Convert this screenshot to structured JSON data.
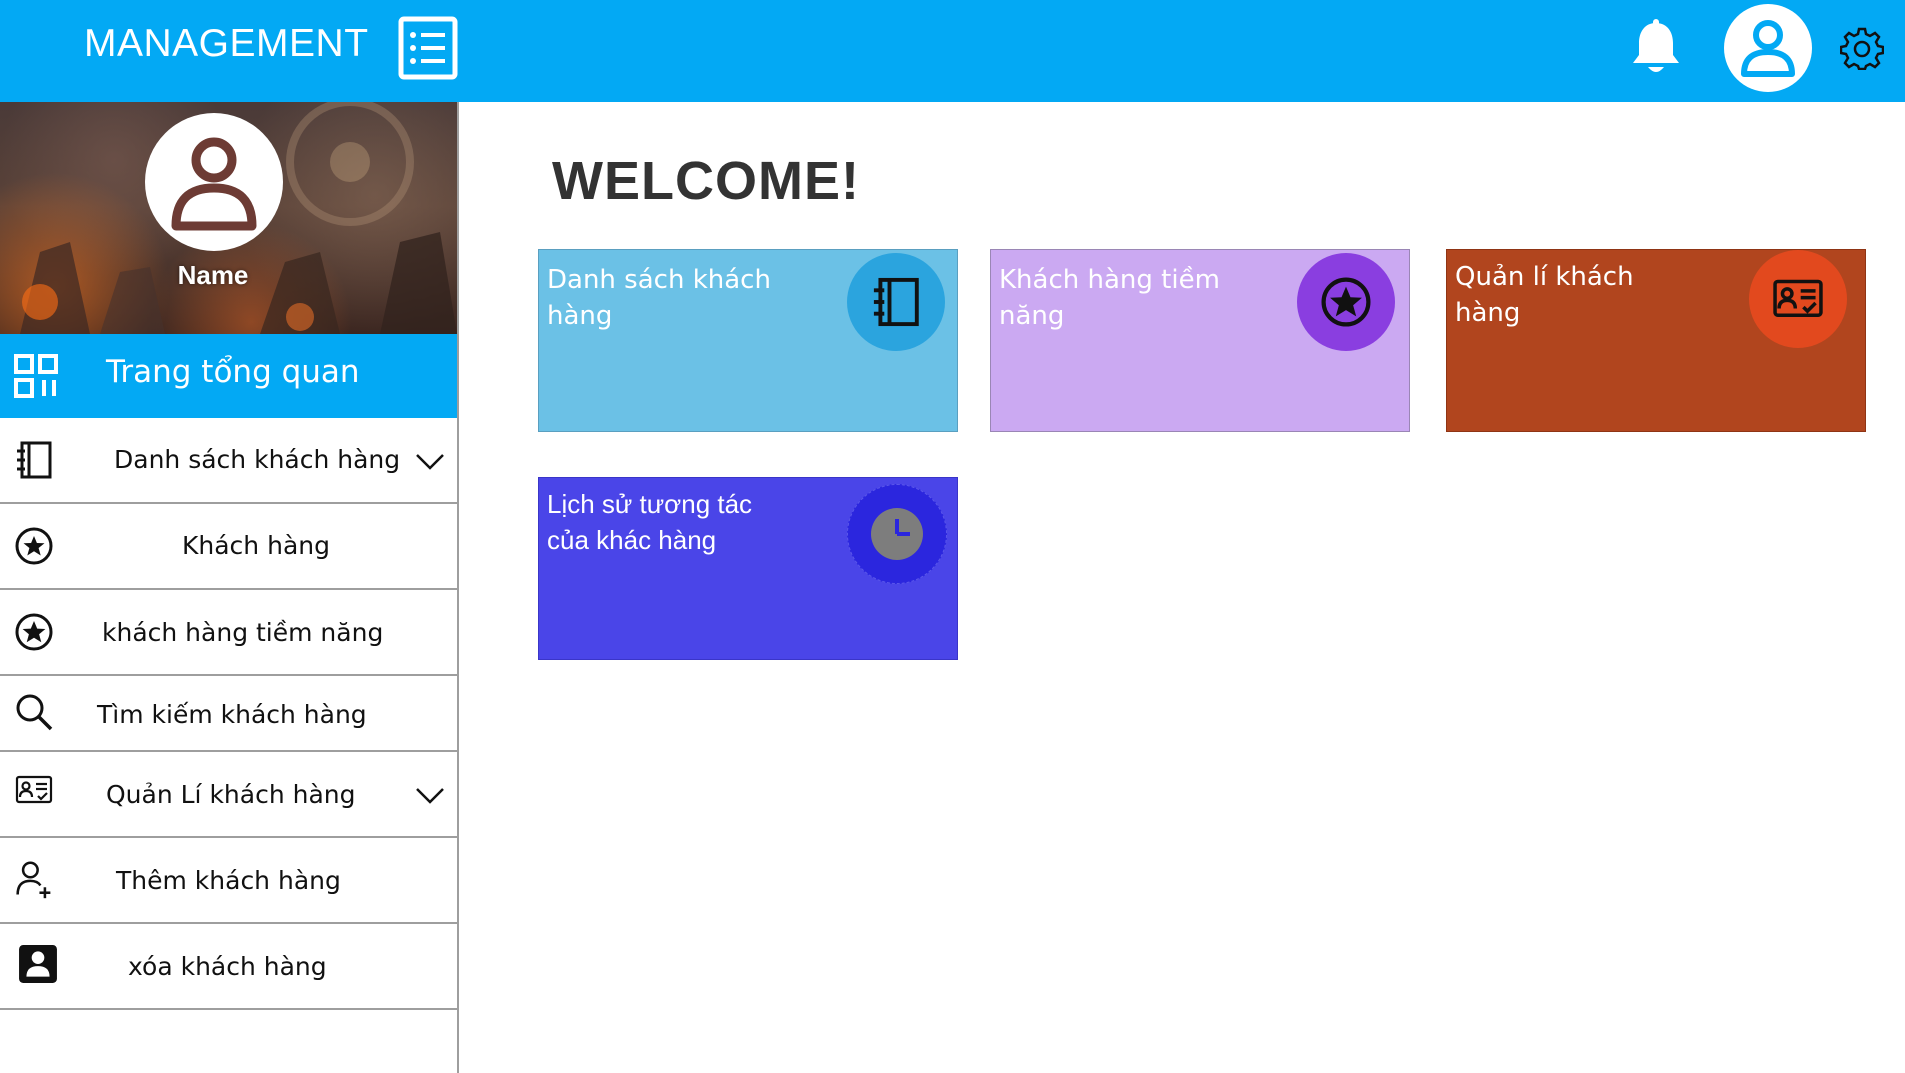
{
  "header": {
    "brand": "MANAGEMENT",
    "icons": {
      "menu": "list-icon",
      "notifications": "bell-icon",
      "user": "user-icon",
      "settings": "gear-icon"
    },
    "color": "#03a9f4"
  },
  "sidebar": {
    "profile": {
      "name": "Name"
    },
    "overview": {
      "label": "Trang tổng quan",
      "icon": "grid-icon"
    },
    "items": [
      {
        "label": "Danh sách khách hàng",
        "icon": "notebook-icon",
        "expandable": true
      },
      {
        "label": "Khách hàng",
        "icon": "star-circle-icon",
        "expandable": false
      },
      {
        "label": "khách hàng tiềm năng",
        "icon": "star-circle-icon",
        "expandable": false
      },
      {
        "label": "Tìm kiếm khách hàng",
        "icon": "search-icon",
        "expandable": false
      },
      {
        "label": "Quản Lí khách hàng",
        "icon": "id-card-icon",
        "expandable": true
      },
      {
        "label": "Thêm khách hàng",
        "icon": "add-user-icon",
        "expandable": false
      },
      {
        "label": "xóa khách hàng",
        "icon": "contact-icon",
        "expandable": false
      }
    ]
  },
  "main": {
    "welcome": "WELCOME!",
    "cards": [
      {
        "title": "Danh sách khách hàng",
        "icon": "notebook-icon",
        "bg": "#6bc1e6",
        "badge": "#2ba4de",
        "text_color": "#ffffff"
      },
      {
        "title": "Khách hàng tiềm năng",
        "icon": "star-circle-icon",
        "bg": "#cba9f2",
        "badge": "#8a3ee0",
        "text_color": "#ffffff"
      },
      {
        "title": "Quản lí khách hàng",
        "icon": "id-card-icon",
        "bg": "#b1451e",
        "badge": "#e2491e",
        "text_color": "#ffffff"
      },
      {
        "title": "Lịch sử tương tác của khác hàng",
        "icon": "clock-icon",
        "bg": "#4a45e8",
        "badge": "#2b26de",
        "text_color": "#ffffff"
      }
    ]
  }
}
